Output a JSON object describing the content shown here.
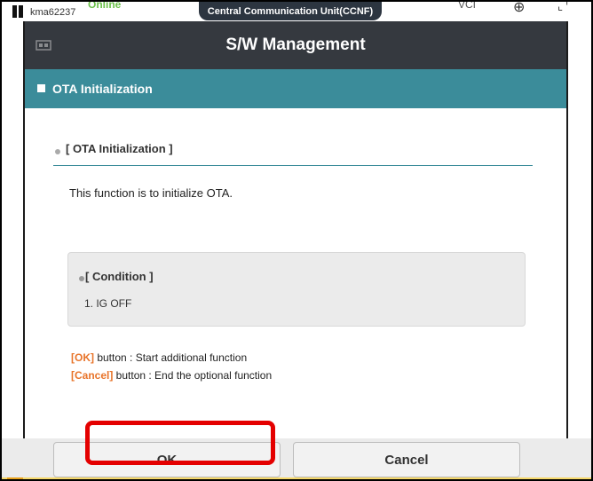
{
  "topbar": {
    "user": "kma62237",
    "status": "Online",
    "unit_title": "Central Communication Unit(CCNF)",
    "vci": "VCI ",
    "colors": {
      "status": "#6cc04a",
      "tab_bg": "#2c3540"
    }
  },
  "header": {
    "title": "S/W Management",
    "icon": "home-icon",
    "bg": "#35393f"
  },
  "section": {
    "label": "OTA Initialization",
    "bg": "#3b8c9a"
  },
  "content": {
    "sub_title": "[ OTA Initialization ]",
    "description": "This function is to initialize OTA.",
    "condition": {
      "title": "[ Condition ]",
      "items": [
        "1. IG OFF"
      ]
    },
    "notes": [
      {
        "key": "[OK]",
        "text": " button : Start additional function"
      },
      {
        "key": "[Cancel]",
        "text": " button : End the optional function"
      }
    ],
    "accent": "#e8742a"
  },
  "footer": {
    "ok_label": "OK",
    "cancel_label": "Cancel"
  },
  "annotation": {
    "color": "#e40000"
  }
}
